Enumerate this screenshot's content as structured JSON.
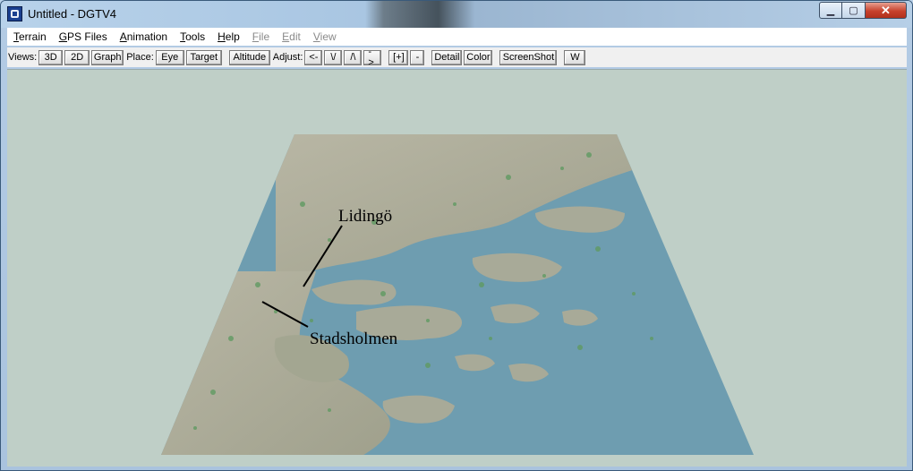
{
  "window": {
    "title": "Untitled - DGTV4"
  },
  "menu": [
    {
      "pre": "",
      "u": "T",
      "rest": "errain",
      "disabled": false
    },
    {
      "pre": "",
      "u": "G",
      "rest": "PS Files",
      "disabled": false
    },
    {
      "pre": "",
      "u": "A",
      "rest": "nimation",
      "disabled": false
    },
    {
      "pre": "",
      "u": "T",
      "rest": "ools",
      "disabled": false
    },
    {
      "pre": "",
      "u": "H",
      "rest": "elp",
      "disabled": false
    },
    {
      "pre": "",
      "u": "F",
      "rest": "ile",
      "disabled": true
    },
    {
      "pre": "",
      "u": "E",
      "rest": "dit",
      "disabled": true
    },
    {
      "pre": "",
      "u": "V",
      "rest": "iew",
      "disabled": true
    }
  ],
  "toolbar": {
    "views_label": "Views:",
    "place_label": "Place:",
    "adjust_label": "Adjust:",
    "btn_3d": "3D",
    "btn_2d": "2D",
    "btn_graph": "Graph",
    "btn_eye": "Eye",
    "btn_target": "Target",
    "btn_altitude": "Altitude",
    "btn_left": "<-",
    "btn_down": "\\/",
    "btn_up": "/\\",
    "btn_right": "->",
    "btn_zoom_in": "[+]",
    "btn_zoom_out": "-",
    "btn_detail": "Detail",
    "btn_color": "Color",
    "btn_screenshot": "ScreenShot",
    "btn_w": "W"
  },
  "map": {
    "label_1": "Lidingö",
    "label_2": "Stadsholmen",
    "colors": {
      "land": "#a3a691",
      "water": "#6e9db0",
      "veg": "#5f9a62",
      "background": "#bfcfc7"
    }
  }
}
